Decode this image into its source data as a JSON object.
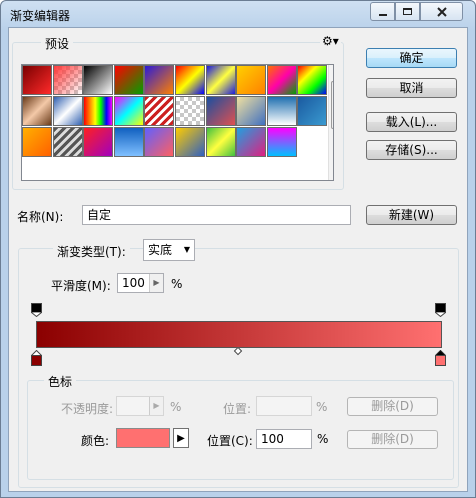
{
  "window": {
    "title": "渐变编辑器"
  },
  "presets": {
    "label": "预设",
    "swatches": [
      {
        "bg": "linear-gradient(135deg,#7a0000,#ff2a2a)"
      },
      {
        "bg": "linear-gradient(135deg,#ff3b3b,#ffffff)",
        "checker": true
      },
      {
        "bg": "linear-gradient(135deg,#000000,#ffffff)"
      },
      {
        "bg": "linear-gradient(135deg,#ff0000,#00a000)"
      },
      {
        "bg": "linear-gradient(135deg,#2a1bd8,#ff8000)"
      },
      {
        "bg": "linear-gradient(135deg,#ff0000,#ffff00,#0000ff)"
      },
      {
        "bg": "linear-gradient(135deg,#1a1ae0,#ffff40,#1a1ae0)"
      },
      {
        "bg": "linear-gradient(135deg,#ffd000,#ff8000)"
      },
      {
        "bg": "linear-gradient(135deg,#ff7000,#ff00aa,#00a000)"
      },
      {
        "bg": "linear-gradient(135deg,#ff0000,#ffff00,#00ff00,#0000ff)"
      },
      {
        "bg": "linear-gradient(135deg,#6a3b1a,#f4c9a8,#6a3b1a)"
      },
      {
        "bg": "linear-gradient(135deg,#3060b0,#ffffff,#3060b0)"
      },
      {
        "bg": "linear-gradient(90deg,#ff0000,#ff8000,#ffff00,#00ff00,#0000ff,#ff00ff)"
      },
      {
        "bg": "linear-gradient(135deg,#ff00ff,#00ffff,#ffff00)"
      },
      {
        "bg": "repeating-linear-gradient(135deg,#cc2020 0 3px,#ffffff 3px 6px)"
      },
      {
        "bg": "",
        "checker": true
      },
      {
        "bg": "linear-gradient(135deg,#1a4fa0,#e05050)"
      },
      {
        "bg": "linear-gradient(135deg,#f0e0a0,#4070c0)"
      },
      {
        "bg": "linear-gradient(180deg,#2070b0,#ffffff)"
      },
      {
        "bg": "linear-gradient(135deg,#1a5aa0,#3a9ad0)"
      },
      {
        "bg": "linear-gradient(135deg,#ffb000,#ff6000)"
      },
      {
        "bg": "repeating-linear-gradient(135deg,#555 0 3px,#ddd 3px 6px)"
      },
      {
        "bg": "linear-gradient(135deg,#ff2020,#a000c0)"
      },
      {
        "bg": "linear-gradient(180deg,#1060c0,#80c0ff)"
      },
      {
        "bg": "linear-gradient(135deg,#6060ff,#ff6060)"
      },
      {
        "bg": "linear-gradient(135deg,#ffcc00,#3060c0)"
      },
      {
        "bg": "linear-gradient(135deg,#40c040,#ffff40,#40c040)"
      },
      {
        "bg": "linear-gradient(135deg,#20a0e0,#e02080)"
      },
      {
        "bg": "linear-gradient(180deg,#ff00ff,#00c0ff)"
      }
    ]
  },
  "buttons": {
    "ok": "确定",
    "cancel": "取消",
    "load": "载入(L)...",
    "save": "存储(S)...",
    "new": "新建(W)"
  },
  "name_field": {
    "label": "名称(N):",
    "value": "自定"
  },
  "gradient": {
    "type_label": "渐变类型(T):",
    "type_value": "实底",
    "smooth_label": "平滑度(M):",
    "smooth_value": "100",
    "smooth_unit": "%",
    "preview": "linear-gradient(90deg,#8b0000,#ff7070)",
    "start_color": "#8b0000",
    "end_color": "#ff7070"
  },
  "stops": {
    "label": "色标",
    "opacity_label": "不透明度:",
    "opacity_value": "",
    "opacity_unit": "%",
    "opacity_position_label": "位置:",
    "opacity_position_value": "",
    "opacity_position_unit": "%",
    "delete_label": "删除(D)",
    "color_label": "颜色:",
    "color_value": "#ff7070",
    "color_position_label": "位置(C):",
    "color_position_value": "100",
    "color_position_unit": "%",
    "delete2_label": "删除(D)"
  }
}
